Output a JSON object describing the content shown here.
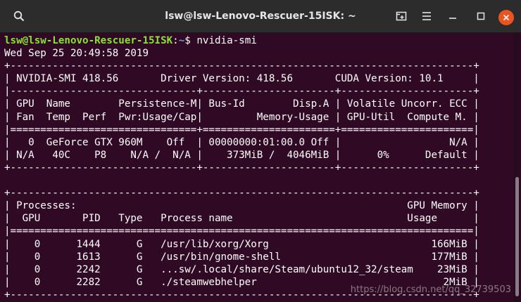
{
  "window": {
    "title": "lsw@lsw-Lenovo-Rescuer-15ISK: ~"
  },
  "titlebar_icons": {
    "search": "search-icon",
    "new_tab": "new-tab-icon",
    "menu": "hamburger-menu-icon",
    "minimize": "minimize-icon",
    "maximize": "maximize-icon",
    "close": "close-icon"
  },
  "colors": {
    "terminal_bg": "#300a24",
    "prompt_user": "#8ae234",
    "prompt_path": "#729fcf",
    "close_button": "#e95420"
  },
  "terminal": {
    "prompt_user_host": "lsw@lsw-Lenovo-Rescuer-15ISK",
    "prompt_sep": ":",
    "prompt_path": "~",
    "prompt_symbol": "$ ",
    "command": "nvidia-smi",
    "lines": [
      "Wed Sep 25 20:49:58 2019",
      "+-----------------------------------------------------------------------------+",
      "| NVIDIA-SMI 418.56       Driver Version: 418.56       CUDA Version: 10.1     |",
      "|-------------------------------+----------------------+----------------------+",
      "| GPU  Name        Persistence-M| Bus-Id        Disp.A | Volatile Uncorr. ECC |",
      "| Fan  Temp  Perf  Pwr:Usage/Cap|         Memory-Usage | GPU-Util  Compute M. |",
      "|===============================+======================+======================|",
      "|   0  GeForce GTX 960M    Off  | 00000000:01:00.0 Off |                  N/A |",
      "| N/A   40C    P8    N/A /  N/A |    373MiB /  4046MiB |      0%      Default |",
      "+-------------------------------+----------------------+----------------------+",
      "",
      "+-----------------------------------------------------------------------------+",
      "| Processes:                                                       GPU Memory |",
      "|  GPU       PID   Type   Process name                             Usage      |",
      "|=============================================================================|",
      "|    0      1444      G   /usr/lib/xorg/Xorg                           166MiB |",
      "|    0      1613      G   /usr/bin/gnome-shell                         177MiB |",
      "|    0      2242      G   ...sw/.local/share/Steam/ubuntu12_32/steam    23MiB |",
      "|    0      2282      G   ./steamwebhelper                               2MiB |",
      "+-----------------------------------------------------------------------------+"
    ]
  },
  "watermark": "https://blog.csdn.net/qq_32739503"
}
